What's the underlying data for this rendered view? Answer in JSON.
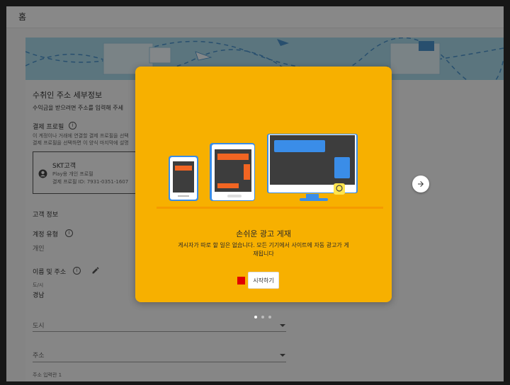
{
  "topbar": {
    "home_label": "홈"
  },
  "page": {
    "section_title": "수취인 주소 세부정보",
    "section_desc": "수익금을 받으려면 주소를 입력해 주세",
    "payment_profile_label": "결제 프로필",
    "payment_profile_desc1": "이 계정이나 거래에 연결할 결제 프로필을 선택",
    "payment_profile_desc2": "결제 프로필을 선택하면 이 양식 마지막에 설명",
    "profile_card": {
      "name": "SKT고객",
      "type": "Play용 개인 프로필",
      "id": "결제 프로필 ID: 7931-0351-1607"
    },
    "customer_info_label": "고객 정보",
    "account_type_label": "계정 유형",
    "account_type_value": "개인",
    "name_address_label": "이름 및 주소",
    "province_label": "도/시",
    "province_value": "경남",
    "city_placeholder": "도시",
    "address_placeholder": "주소",
    "address_line_label": "주소 입력란 1"
  },
  "modal": {
    "title": "손쉬운 광고 게재",
    "desc": "게시자가 따로 할 일은 없습니다. 모든 기기에서 사이트에 자동 광고가 게재됩니다",
    "start_label": "시작하기"
  },
  "carousel": {
    "current_slide": 1,
    "total_slides": 3
  },
  "icons": {
    "help": "help-circle-icon",
    "edit": "pencil-icon",
    "account": "account-circle-icon",
    "next": "arrow-right-icon",
    "dropdown": "triangle-down-icon"
  },
  "colors": {
    "modal_bg": "#f7b000",
    "banner_bg": "#a7d6e6",
    "device_screen": "#3d3d3d",
    "device_blue": "#3a8de8",
    "device_orange": "#f26522",
    "marker_red": "#e00000"
  }
}
